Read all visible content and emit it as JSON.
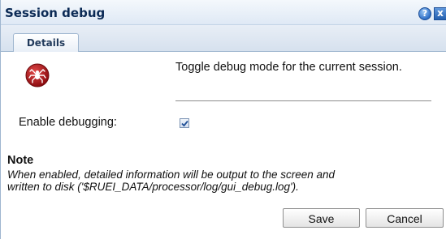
{
  "dialog": {
    "title": "Session debug",
    "help_glyph": "?",
    "close_glyph": "x"
  },
  "tabs": [
    {
      "label": "Details",
      "active": true
    }
  ],
  "content": {
    "icon": "debug-spider-icon",
    "intro_text": "Toggle debug mode for the current session.",
    "enable_debugging_label": "Enable debugging:",
    "enable_debugging_checked": true,
    "note_heading": "Note",
    "note_line1": "When enabled, detailed information will be output to the screen and",
    "note_line2": "written to disk ('$RUEI_DATA/processor/log/gui_debug.log')."
  },
  "buttons": {
    "save_label": "Save",
    "cancel_label": "Cancel"
  },
  "colors": {
    "title_text": "#0b2a55",
    "icon_red": "#b01417",
    "tab_border": "#9fb6cf"
  }
}
